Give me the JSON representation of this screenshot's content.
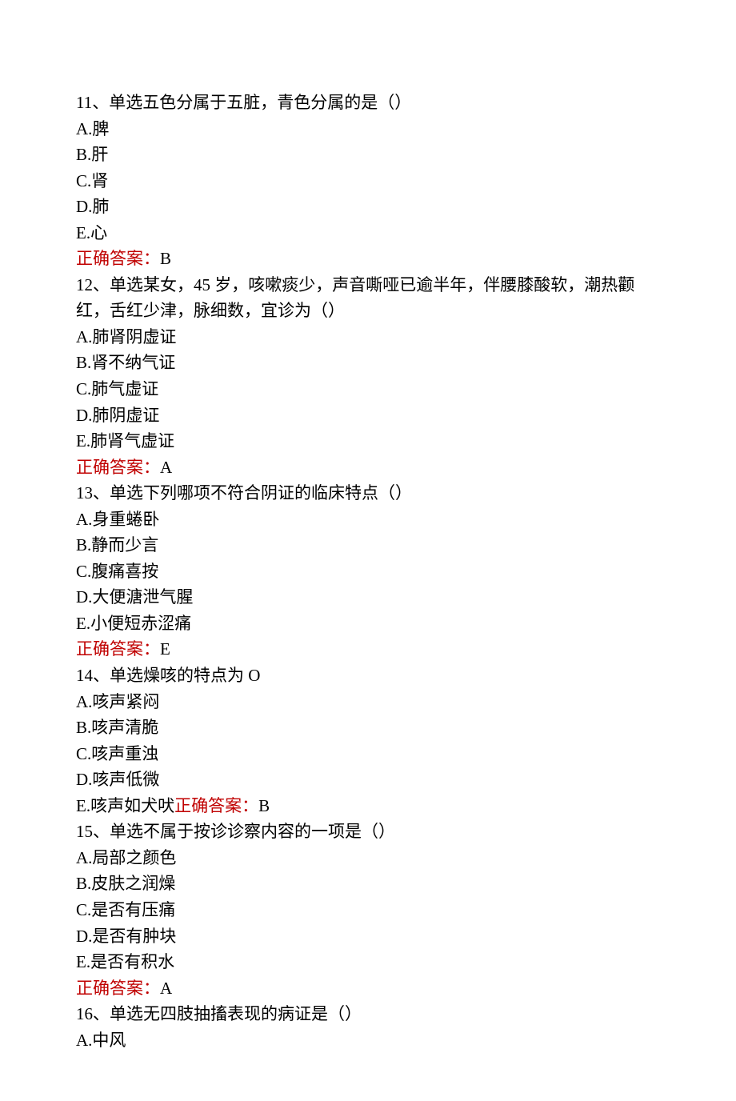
{
  "answer_label": "正确答案：",
  "questions": [
    {
      "num": "11",
      "prefix": "、单选",
      "stem": "五色分属于五脏，青色分属的是（）",
      "options": [
        {
          "letter": "A",
          "text": "脾"
        },
        {
          "letter": "B",
          "text": "肝"
        },
        {
          "letter": "C",
          "text": "肾"
        },
        {
          "letter": "D",
          "text": "肺"
        },
        {
          "letter": "E",
          "text": "心"
        }
      ],
      "answer": "B",
      "answer_inline": false
    },
    {
      "num": "12",
      "prefix": "、单选",
      "stem": "某女，45 岁，咳嗽痰少，声音嘶哑已逾半年，伴腰膝酸软，潮热颧红，舌红少津，脉细数，宜诊为（）",
      "options": [
        {
          "letter": "A",
          "text": "肺肾阴虚证"
        },
        {
          "letter": "B",
          "text": "肾不纳气证"
        },
        {
          "letter": "C",
          "text": "肺气虚证"
        },
        {
          "letter": "D",
          "text": "肺阴虚证"
        },
        {
          "letter": "E",
          "text": "肺肾气虚证"
        }
      ],
      "answer": "A",
      "answer_inline": false
    },
    {
      "num": "13",
      "prefix": "、单选",
      "stem": "下列哪项不符合阴证的临床特点（）",
      "options": [
        {
          "letter": "A",
          "text": "身重蜷卧"
        },
        {
          "letter": "B",
          "text": "静而少言"
        },
        {
          "letter": "C",
          "text": "腹痛喜按"
        },
        {
          "letter": "D",
          "text": "大便溏泄气腥"
        },
        {
          "letter": "E",
          "text": "小便短赤涩痛"
        }
      ],
      "answer": "E",
      "answer_inline": false
    },
    {
      "num": "14",
      "prefix": "、单选",
      "stem": "燥咳的特点为 O",
      "options": [
        {
          "letter": "A",
          "text": "咳声紧闷"
        },
        {
          "letter": "B",
          "text": "咳声清脆"
        },
        {
          "letter": "C",
          "text": "咳声重浊"
        },
        {
          "letter": "D",
          "text": "咳声低微"
        },
        {
          "letter": "E",
          "text": "咳声如犬吠"
        }
      ],
      "answer": "B",
      "answer_inline": true
    },
    {
      "num": "15",
      "prefix": "、单选",
      "stem": "不属于按诊诊察内容的一项是（）",
      "options": [
        {
          "letter": "A",
          "text": "局部之颜色"
        },
        {
          "letter": "B",
          "text": "皮肤之润燥"
        },
        {
          "letter": "C",
          "text": "是否有压痛"
        },
        {
          "letter": "D",
          "text": "是否有肿块"
        },
        {
          "letter": "E",
          "text": "是否有积水"
        }
      ],
      "answer": "A",
      "answer_inline": false
    },
    {
      "num": "16",
      "prefix": "、单选",
      "stem": "无四肢抽搐表现的病证是（）",
      "options": [
        {
          "letter": "A",
          "text": "中风"
        }
      ],
      "answer": null,
      "answer_inline": false
    }
  ]
}
